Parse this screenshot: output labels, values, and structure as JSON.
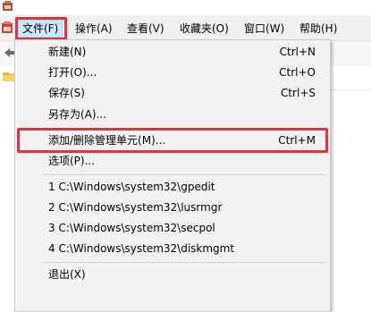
{
  "menubar": {
    "items": [
      {
        "label": "文件(F)"
      },
      {
        "label": "操作(A)"
      },
      {
        "label": "查看(V)"
      },
      {
        "label": "收藏夹(O)"
      },
      {
        "label": "窗口(W)"
      },
      {
        "label": "帮助(H)"
      }
    ]
  },
  "file_menu": {
    "new": {
      "label": "新建(N)",
      "shortcut": "Ctrl+N"
    },
    "open": {
      "label": "打开(O)...",
      "shortcut": "Ctrl+O"
    },
    "save": {
      "label": "保存(S)",
      "shortcut": "Ctrl+S"
    },
    "save_as": {
      "label": "另存为(A)..."
    },
    "add_remove_snapin": {
      "label": "添加/删除管理单元(M)...",
      "shortcut": "Ctrl+M"
    },
    "options": {
      "label": "选项(P)..."
    },
    "recent": [
      {
        "label": "1 C:\\Windows\\system32\\gpedit"
      },
      {
        "label": "2 C:\\Windows\\system32\\lusrmgr"
      },
      {
        "label": "3 C:\\Windows\\system32\\secpol"
      },
      {
        "label": "4 C:\\Windows\\system32\\diskmgmt"
      }
    ],
    "exit": {
      "label": "退出(X)"
    }
  },
  "colors": {
    "highlight_border": "#e03340",
    "menu_active_bg": "#cce8ff",
    "menu_bg": "#f2f2f2"
  },
  "icons": [
    "mmc-app-icon",
    "back-arrow-icon",
    "folder-icon"
  ]
}
